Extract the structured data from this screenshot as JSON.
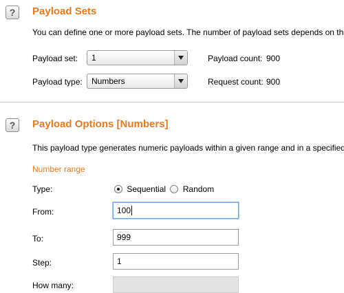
{
  "payload_sets": {
    "title": "Payload Sets",
    "help_icon": "?",
    "description": "You can define one or more payload sets. The number of payload sets depends on the",
    "payload_set_label": "Payload set:",
    "payload_set_value": "1",
    "payload_count_label": "Payload count:",
    "payload_count_value": "900",
    "payload_type_label": "Payload type:",
    "payload_type_value": "Numbers",
    "request_count_label": "Request count:",
    "request_count_value": "900"
  },
  "payload_options": {
    "title": "Payload Options [Numbers]",
    "help_icon": "?",
    "description": "This payload type generates numeric payloads within a given range and in a specified",
    "number_range_heading": "Number range",
    "type_label": "Type:",
    "type_options": [
      "Sequential",
      "Random"
    ],
    "type_selected": "Sequential",
    "from_label": "From:",
    "from_value": "100",
    "to_label": "To:",
    "to_value": "999",
    "step_label": "Step:",
    "step_value": "1",
    "how_many_label": "How many:",
    "how_many_value": ""
  },
  "colors": {
    "accent": "#e8791e",
    "focus_border": "#6aa3e0",
    "disabled_bg": "#e4e4e4"
  }
}
